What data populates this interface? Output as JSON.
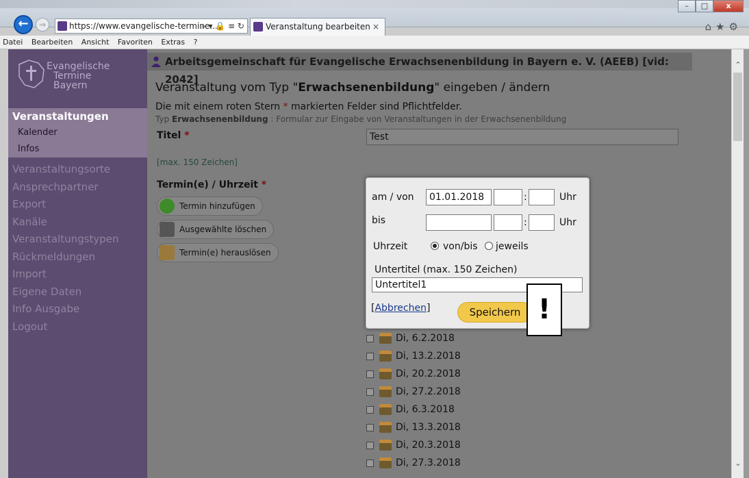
{
  "browser": {
    "address": "https://www.evangelische-termine...",
    "address_tools": "⌕ ▾ 🔒 ≡ ↻",
    "tab_title": "Veranstaltung bearbeiten",
    "tab_close": "×",
    "back": "←",
    "forward": "⇒",
    "right_icons": "⌂★⚙",
    "win_min": "–",
    "win_max": "□",
    "win_close": "x",
    "menu": [
      "Datei",
      "Bearbeiten",
      "Ansicht",
      "Favoriten",
      "Extras",
      "?"
    ]
  },
  "logo": {
    "line1": "Evangelische",
    "line2": "Termine",
    "line3": "Bayern"
  },
  "sidebar": {
    "section": "Veranstaltungen",
    "sub_items": [
      "Kalender",
      "Infos"
    ],
    "items": [
      "Veranstaltungsorte",
      "Ansprechpartner",
      "Export",
      "Kanäle",
      "Veranstaltungstypen",
      "Rückmeldungen",
      "Import",
      "Eigene Daten",
      "Info Ausgabe",
      "Logout"
    ]
  },
  "header": {
    "org": "Arbeitsgemeinschaft für Evangelische Erwachsenenbildung in Bayern e. V. (AEEB) [vid: 2042]"
  },
  "page": {
    "title_prefix": "Veranstaltung vom Typ \"",
    "title_type": "Erwachsenenbildung",
    "title_suffix": "\" eingeben / ändern",
    "required_pre": "Die mit einem roten Stern ",
    "required_star": "*",
    "required_post": " markierten Felder sind Pflichtfelder.",
    "type_pre": "Typ ",
    "type_name": "Erwachsenenbildung",
    "type_post": " : Formular zur Eingabe von Veranstaltungen in der Erwachsenenbildung",
    "titel_label": "Titel",
    "titel_value": "Test",
    "max_hint": "[max. 150 Zeichen]",
    "termin_label": "Termin(e) / Uhrzeit",
    "star": "*",
    "buttons": {
      "add": "Termin hinzufügen",
      "delete": "Ausgewählte löschen",
      "extract": "Termin(e) herauslösen"
    },
    "dates": [
      "Di, 6.2.2018",
      "Di, 13.2.2018",
      "Di, 20.2.2018",
      "Di, 27.2.2018",
      "Di, 6.3.2018",
      "Di, 13.3.2018",
      "Di, 20.3.2018",
      "Di, 27.3.2018"
    ]
  },
  "dialog": {
    "am_von_label": "am / von",
    "am_von_date": "01.01.2018",
    "bis_label": "bis",
    "colon": ":",
    "uhr": "Uhr",
    "uhrzeit_label": "Uhrzeit",
    "radio_vonbis": "von/bis",
    "radio_jeweils": "jeweils",
    "untertitel_label": "Untertitel (max. 150 Zeichen)",
    "untertitel_value": "Untertitel1",
    "cancel_open": "[",
    "cancel_text": "Abbrechen",
    "cancel_close": "]",
    "save": "Speichern"
  },
  "alert": {
    "symbol": "!"
  },
  "scroll": {
    "up": "⌃",
    "down": "⌄"
  }
}
